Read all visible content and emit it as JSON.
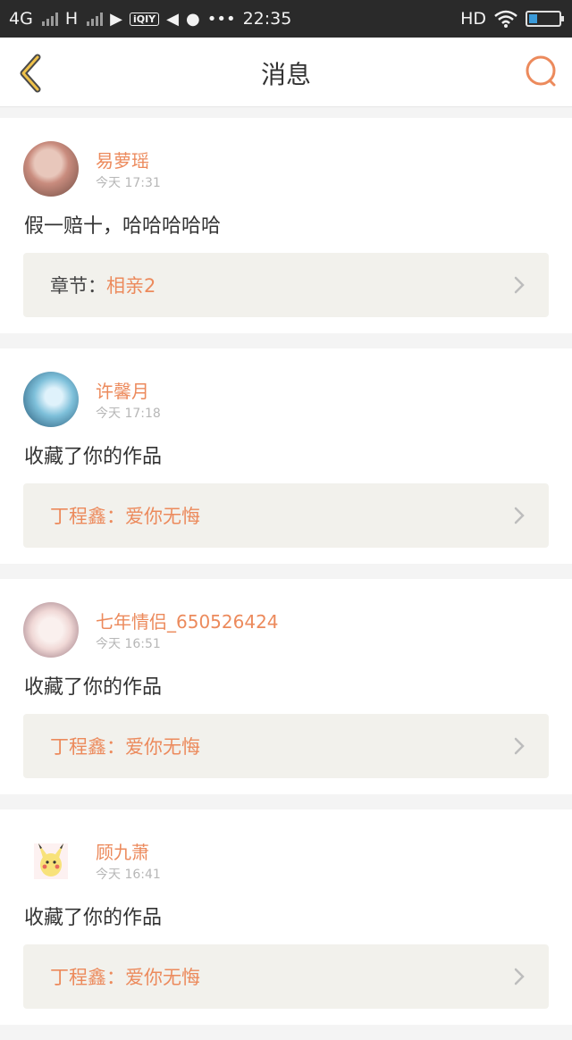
{
  "status_bar": {
    "network_4g": "4G",
    "network_h": "H",
    "time": "22:35",
    "hd": "HD",
    "iqiyi_label": "iQIY",
    "icons": [
      "play-icon",
      "iqiyi-icon",
      "mute-icon",
      "palette-icon",
      "more-icon",
      "wifi-icon",
      "battery-icon"
    ]
  },
  "header": {
    "title": "消息",
    "back_icon": "chevron-left-icon",
    "search_icon": "search-icon",
    "accent": "#ec8a5c"
  },
  "messages": [
    {
      "user": "易萝瑶",
      "time": "今天 17:31",
      "text": "假一赔十，哈哈哈哈哈",
      "ref_label": "章节：",
      "ref_value": "相亲2",
      "avatar_colors": [
        "#c98c7e",
        "#6d4b42"
      ]
    },
    {
      "user": "许馨月",
      "time": "今天 17:18",
      "text": "收藏了你的作品",
      "ref_label": "丁程鑫：",
      "ref_value": "爱你无悔",
      "avatar_colors": [
        "#7ec0da",
        "#1f4f6e"
      ]
    },
    {
      "user": "七年情侣_650526424",
      "time": "今天 16:51",
      "text": "收藏了你的作品",
      "ref_label": "丁程鑫：",
      "ref_value": "爱你无悔",
      "avatar_colors": [
        "#f0d8d6",
        "#8e6b76"
      ]
    },
    {
      "user": "顾九萧",
      "time": "今天 16:41",
      "text": "收藏了你的作品",
      "ref_label": "丁程鑫：",
      "ref_value": "爱你无悔",
      "avatar_colors": [
        "#f8e27a",
        "#e8b040"
      ]
    }
  ]
}
